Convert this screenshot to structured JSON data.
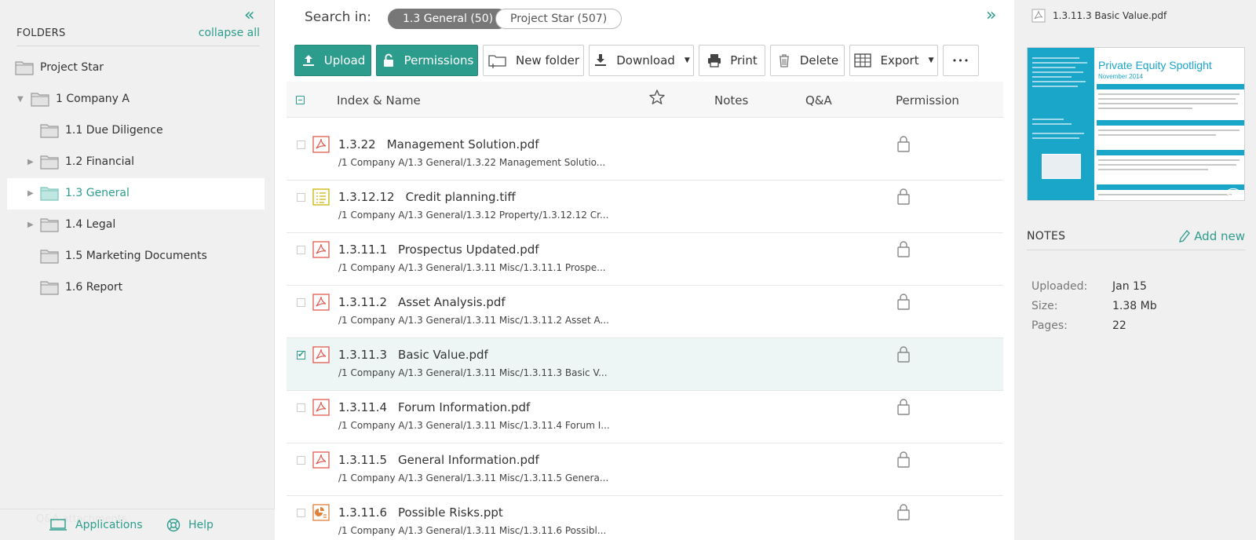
{
  "sidebar": {
    "title": "FOLDERS",
    "collapse_all": "collapse all",
    "collapse_icon": "double-chevron-left-icon",
    "items": [
      {
        "label": "Project Star",
        "level": 0,
        "caret": "none"
      },
      {
        "label": "1 Company A",
        "level": 1,
        "caret": "expanded"
      },
      {
        "label": "1.1 Due Diligence",
        "level": 2,
        "caret": "none"
      },
      {
        "label": "1.2 Financial",
        "level": 2,
        "caret": "collapsed"
      },
      {
        "label": "1.3 General",
        "level": 2,
        "caret": "collapsed",
        "selected": true
      },
      {
        "label": "1.4 Legal",
        "level": 2,
        "caret": "collapsed"
      },
      {
        "label": "1.5 Marketing Documents",
        "level": 2,
        "caret": "none"
      },
      {
        "label": "1.6 Report",
        "level": 2,
        "caret": "none"
      }
    ],
    "footer": {
      "ghost_text": "Q&A attachments",
      "applications": "Applications",
      "help": "Help"
    }
  },
  "search": {
    "label": "Search in:",
    "scope_active": "1.3 General (50)",
    "scope_other": "Project Star (507)"
  },
  "toolbar": {
    "upload": "Upload",
    "permissions": "Permissions",
    "new_folder": "New folder",
    "download": "Download",
    "print": "Print",
    "delete": "Delete",
    "export": "Export",
    "more": "•••"
  },
  "table": {
    "headers": {
      "name": "Index & Name",
      "notes": "Notes",
      "qa": "Q&A",
      "permission": "Permission"
    },
    "rows": [
      {
        "index": "1.3.22",
        "name": "Management Solution.pdf",
        "path": "/1 Company A/1.3 General/1.3.22 Management Solutio...",
        "type": "pdf",
        "checked": false
      },
      {
        "index": "1.3.12.12",
        "name": "Credit planning.tiff",
        "path": "/1 Company A/1.3 General/1.3.12 Property/1.3.12.12 Cr...",
        "type": "tiff",
        "checked": false
      },
      {
        "index": "1.3.11.1",
        "name": "Prospectus Updated.pdf",
        "path": "/1 Company A/1.3 General/1.3.11 Misc/1.3.11.1 Prospe...",
        "type": "pdf",
        "checked": false
      },
      {
        "index": "1.3.11.2",
        "name": "Asset Analysis.pdf",
        "path": "/1 Company A/1.3 General/1.3.11 Misc/1.3.11.2 Asset A...",
        "type": "pdf",
        "checked": false
      },
      {
        "index": "1.3.11.3",
        "name": "Basic Value.pdf",
        "path": "/1 Company A/1.3 General/1.3.11 Misc/1.3.11.3 Basic V...",
        "type": "pdf",
        "checked": true
      },
      {
        "index": "1.3.11.4",
        "name": "Forum Information.pdf",
        "path": "/1 Company A/1.3 General/1.3.11 Misc/1.3.11.4 Forum I...",
        "type": "pdf",
        "checked": false
      },
      {
        "index": "1.3.11.5",
        "name": "General Information.pdf",
        "path": "/1 Company A/1.3 General/1.3.11 Misc/1.3.11.5 Genera...",
        "type": "pdf",
        "checked": false
      },
      {
        "index": "1.3.11.6",
        "name": "Possible Risks.ppt",
        "path": "/1 Company A/1.3 General/1.3.11 Misc/1.3.11.6 Possibl...",
        "type": "ppt",
        "checked": false
      }
    ]
  },
  "details": {
    "file_name": "1.3.11.3 Basic Value.pdf",
    "preview": {
      "title": "Private Equity Spotlight",
      "subtitle": "November 2014"
    },
    "notes_title": "NOTES",
    "add_new": "Add new",
    "meta": [
      {
        "key": "Uploaded:",
        "value": "Jan 15"
      },
      {
        "key": "Size:",
        "value": "1.38 Mb"
      },
      {
        "key": "Pages:",
        "value": "22"
      }
    ]
  },
  "colors": {
    "accent": "#2c9c8c",
    "pdf": "#e05a4f",
    "tiff": "#c9b400",
    "ppt": "#e0803a"
  }
}
